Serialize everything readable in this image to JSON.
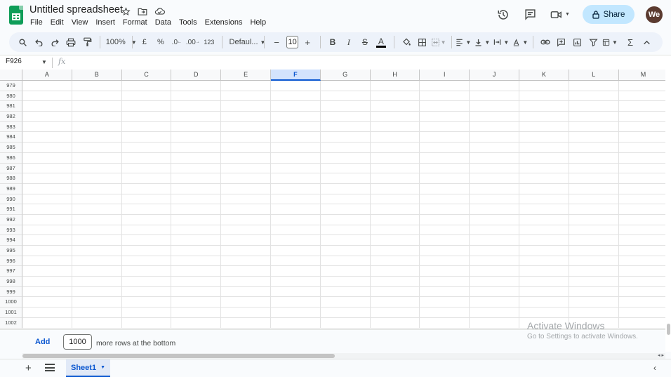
{
  "app": {
    "title": "Untitled spreadsheet",
    "menu": [
      "File",
      "Edit",
      "View",
      "Insert",
      "Format",
      "Data",
      "Tools",
      "Extensions",
      "Help"
    ],
    "share_label": "Share",
    "avatar_initials": "We"
  },
  "toolbar": {
    "zoom": "100%",
    "currency": "£",
    "percent": "%",
    "dec_decrease": ".0",
    "dec_increase": ".00",
    "number_format": "123",
    "font": "Defaul...",
    "font_size": "10",
    "minus": "−",
    "plus": "+",
    "bold": "B",
    "italic": "I",
    "strike": "S",
    "text_color": "A",
    "sum": "Σ"
  },
  "formula_bar": {
    "cell_ref": "F926",
    "fx": "fx"
  },
  "grid": {
    "columns": [
      "A",
      "B",
      "C",
      "D",
      "E",
      "F",
      "G",
      "H",
      "I",
      "J",
      "K",
      "L",
      "M"
    ],
    "active_column": "F",
    "rows": [
      "979",
      "980",
      "981",
      "982",
      "983",
      "984",
      "985",
      "986",
      "987",
      "988",
      "989",
      "990",
      "991",
      "992",
      "993",
      "994",
      "995",
      "996",
      "997",
      "998",
      "999",
      "1000",
      "1001",
      "1002"
    ]
  },
  "add_rows": {
    "button": "Add",
    "count": "1000",
    "suffix": "more rows at the bottom"
  },
  "watermark": {
    "line1": "Activate Windows",
    "line2": "Go to Settings to activate Windows."
  },
  "sheets": {
    "tabs": [
      "Sheet1"
    ],
    "add": "+"
  },
  "colors": {
    "accent": "#0b57d0",
    "share_bg": "#c2e7ff",
    "toolbar_bg": "#edf2fa",
    "sheets_green": "#0f9d58"
  }
}
